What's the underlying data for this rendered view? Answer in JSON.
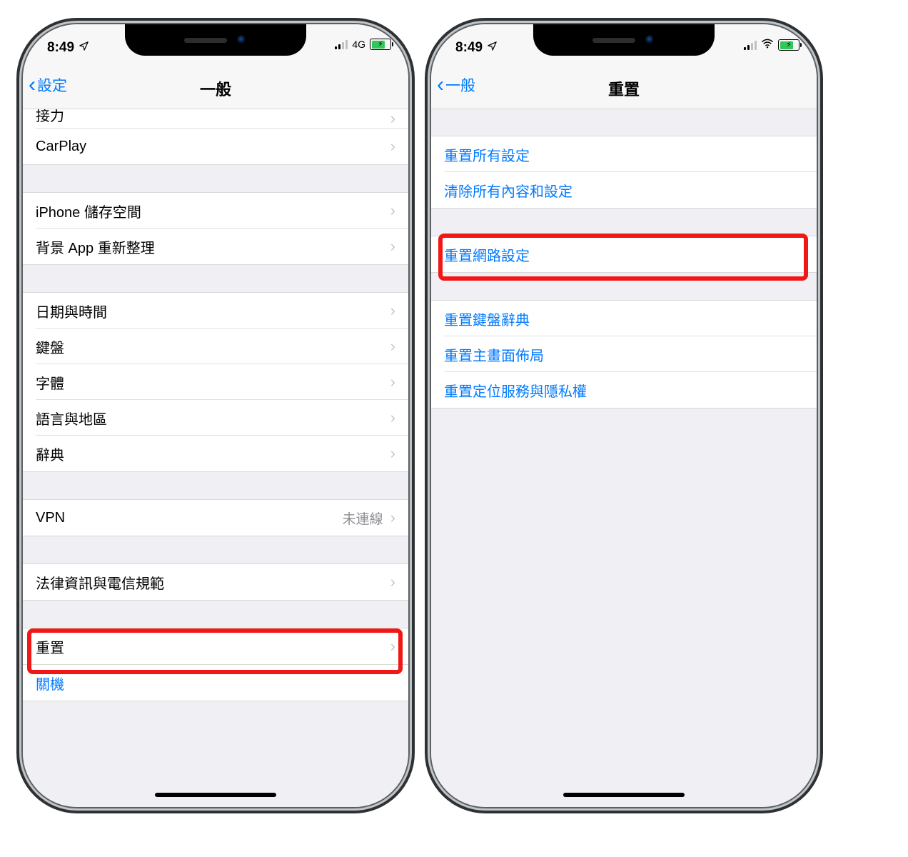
{
  "left": {
    "status": {
      "time": "8:49",
      "net_label": "4G",
      "battery_pct": 70
    },
    "navbar": {
      "back": "設定",
      "title": "一般"
    },
    "rows": {
      "partial_top": "接力",
      "carplay": "CarPlay",
      "storage": "iPhone 儲存空間",
      "bg_refresh": "背景 App 重新整理",
      "datetime": "日期與時間",
      "keyboard": "鍵盤",
      "fonts": "字體",
      "lang_region": "語言與地區",
      "dictionary": "辭典",
      "vpn": "VPN",
      "vpn_status": "未連線",
      "legal": "法律資訊與電信規範",
      "reset": "重置",
      "shutdown": "關機"
    }
  },
  "right": {
    "status": {
      "time": "8:49",
      "battery_pct": 70
    },
    "navbar": {
      "back": "一般",
      "title": "重置"
    },
    "rows": {
      "reset_all": "重置所有設定",
      "erase_all": "清除所有內容和設定",
      "reset_network": "重置網路設定",
      "reset_keyboard": "重置鍵盤辭典",
      "reset_home": "重置主畫面佈局",
      "reset_location": "重置定位服務與隱私權"
    }
  }
}
